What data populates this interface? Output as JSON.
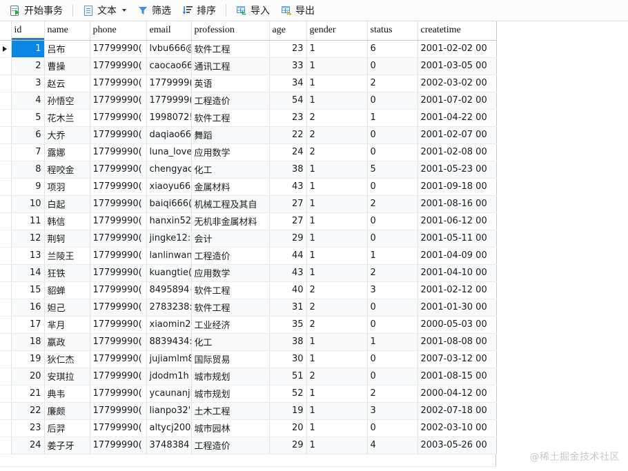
{
  "toolbar": {
    "items": [
      {
        "id": "begin-transaction",
        "label": "开始事务",
        "icon": "transaction-icon",
        "caret": false
      },
      {
        "id": "text",
        "label": "文本",
        "icon": "document-icon",
        "caret": true
      },
      {
        "id": "filter",
        "label": "筛选",
        "icon": "funnel-icon",
        "caret": false
      },
      {
        "id": "sort",
        "label": "排序",
        "icon": "sort-icon",
        "caret": false
      },
      {
        "id": "import",
        "label": "导入",
        "icon": "import-grid-icon",
        "caret": false
      },
      {
        "id": "export",
        "label": "导出",
        "icon": "export-grid-icon",
        "caret": false
      }
    ]
  },
  "grid": {
    "sorted_column": "id",
    "selected_row_index": 0,
    "selection_color": "#0a86e3",
    "sorted_header_bg": "#e6f0fa",
    "alt_row_bg": "#f7f9fb",
    "columns": [
      {
        "key": "id",
        "label": "id",
        "align": "right"
      },
      {
        "key": "name",
        "label": "name",
        "align": "left"
      },
      {
        "key": "phone",
        "label": "phone",
        "align": "left"
      },
      {
        "key": "email",
        "label": "email",
        "align": "left"
      },
      {
        "key": "profession",
        "label": "profession",
        "align": "left"
      },
      {
        "key": "age",
        "label": "age",
        "align": "right"
      },
      {
        "key": "gender",
        "label": "gender",
        "align": "left"
      },
      {
        "key": "status",
        "label": "status",
        "align": "left"
      },
      {
        "key": "createtime",
        "label": "createtime",
        "align": "left"
      }
    ],
    "rows": [
      {
        "id": "1",
        "name": "吕布",
        "phone": "17799990(",
        "email": "lvbu666@",
        "profession": "软件工程",
        "age": "23",
        "gender": "1",
        "status": "6",
        "createtime": "2001-02-02 00"
      },
      {
        "id": "2",
        "name": "曹操",
        "phone": "17799990(",
        "email": "caocao66",
        "profession": "通讯工程",
        "age": "33",
        "gender": "1",
        "status": "0",
        "createtime": "2001-03-05 00"
      },
      {
        "id": "3",
        "name": "赵云",
        "phone": "17799990(",
        "email": "1779999(",
        "profession": "英语",
        "age": "34",
        "gender": "1",
        "status": "2",
        "createtime": "2002-03-02 00"
      },
      {
        "id": "4",
        "name": "孙悟空",
        "phone": "17799990(",
        "email": "1779999(",
        "profession": "工程造价",
        "age": "54",
        "gender": "1",
        "status": "0",
        "createtime": "2001-07-02 00"
      },
      {
        "id": "5",
        "name": "花木兰",
        "phone": "17799990(",
        "email": "1998072!",
        "profession": "软件工程",
        "age": "23",
        "gender": "2",
        "status": "1",
        "createtime": "2001-04-22 00"
      },
      {
        "id": "6",
        "name": "大乔",
        "phone": "17799990(",
        "email": "daqiao66",
        "profession": "舞蹈",
        "age": "22",
        "gender": "2",
        "status": "0",
        "createtime": "2001-02-07 00"
      },
      {
        "id": "7",
        "name": "露娜",
        "phone": "17799990(",
        "email": "luna_love",
        "profession": "应用数学",
        "age": "24",
        "gender": "2",
        "status": "0",
        "createtime": "2001-02-08 00"
      },
      {
        "id": "8",
        "name": "程咬金",
        "phone": "17799990(",
        "email": "chengyac",
        "profession": "化工",
        "age": "38",
        "gender": "1",
        "status": "5",
        "createtime": "2001-05-23 00"
      },
      {
        "id": "9",
        "name": "项羽",
        "phone": "17799990(",
        "email": "xiaoyu66",
        "profession": "金属材料",
        "age": "43",
        "gender": "1",
        "status": "0",
        "createtime": "2001-09-18 00"
      },
      {
        "id": "10",
        "name": "白起",
        "phone": "17799990(",
        "email": "baiqi666(",
        "profession": "机械工程及其自",
        "age": "27",
        "gender": "1",
        "status": "2",
        "createtime": "2001-08-16 00"
      },
      {
        "id": "11",
        "name": "韩信",
        "phone": "17799990(",
        "email": "hanxin52(",
        "profession": "无机非金属材料",
        "age": "27",
        "gender": "1",
        "status": "0",
        "createtime": "2001-06-12 00"
      },
      {
        "id": "12",
        "name": "荆轲",
        "phone": "17799990(",
        "email": "jingke12:",
        "profession": "会计",
        "age": "29",
        "gender": "1",
        "status": "0",
        "createtime": "2001-05-11 00"
      },
      {
        "id": "13",
        "name": "兰陵王",
        "phone": "17799990(",
        "email": "lanlinwan",
        "profession": "工程造价",
        "age": "44",
        "gender": "1",
        "status": "1",
        "createtime": "2001-04-09 00"
      },
      {
        "id": "14",
        "name": "狂铁",
        "phone": "17799990(",
        "email": "kuangtie(",
        "profession": "应用数学",
        "age": "43",
        "gender": "1",
        "status": "2",
        "createtime": "2001-04-10 00"
      },
      {
        "id": "15",
        "name": "貂蝉",
        "phone": "17799990(",
        "email": "8495894{",
        "profession": "软件工程",
        "age": "40",
        "gender": "2",
        "status": "3",
        "createtime": "2001-02-12 00"
      },
      {
        "id": "16",
        "name": "妲己",
        "phone": "17799990(",
        "email": "2783238:",
        "profession": "软件工程",
        "age": "31",
        "gender": "2",
        "status": "0",
        "createtime": "2001-01-30 00"
      },
      {
        "id": "17",
        "name": "芈月",
        "phone": "17799990(",
        "email": "xiaomin2",
        "profession": "工业经济",
        "age": "35",
        "gender": "2",
        "status": "0",
        "createtime": "2000-05-03 00"
      },
      {
        "id": "18",
        "name": "嬴政",
        "phone": "17799990(",
        "email": "8839434:",
        "profession": "化工",
        "age": "38",
        "gender": "1",
        "status": "1",
        "createtime": "2001-08-08 00"
      },
      {
        "id": "19",
        "name": "狄仁杰",
        "phone": "17799990(",
        "email": "jujiamlm8",
        "profession": "国际贸易",
        "age": "30",
        "gender": "1",
        "status": "0",
        "createtime": "2007-03-12 00"
      },
      {
        "id": "20",
        "name": "安琪拉",
        "phone": "17799990(",
        "email": "jdodm1h",
        "profession": "城市规划",
        "age": "51",
        "gender": "2",
        "status": "0",
        "createtime": "2001-08-15 00"
      },
      {
        "id": "21",
        "name": "典韦",
        "phone": "17799990(",
        "email": "ycaunanji",
        "profession": "城市规划",
        "age": "52",
        "gender": "1",
        "status": "2",
        "createtime": "2000-04-12 00"
      },
      {
        "id": "22",
        "name": "廉颇",
        "phone": "17799990(",
        "email": "lianpo32'",
        "profession": "土木工程",
        "age": "19",
        "gender": "1",
        "status": "3",
        "createtime": "2002-07-18 00"
      },
      {
        "id": "23",
        "name": "后羿",
        "phone": "17799990(",
        "email": "altycj200",
        "profession": "城市园林",
        "age": "20",
        "gender": "1",
        "status": "0",
        "createtime": "2002-03-10 00"
      },
      {
        "id": "24",
        "name": "姜子牙",
        "phone": "17799990(",
        "email": "3748384",
        "profession": "工程造价",
        "age": "29",
        "gender": "1",
        "status": "4",
        "createtime": "2003-05-26 00"
      }
    ]
  },
  "watermark": {
    "text": "@稀土掘金技术社区"
  }
}
